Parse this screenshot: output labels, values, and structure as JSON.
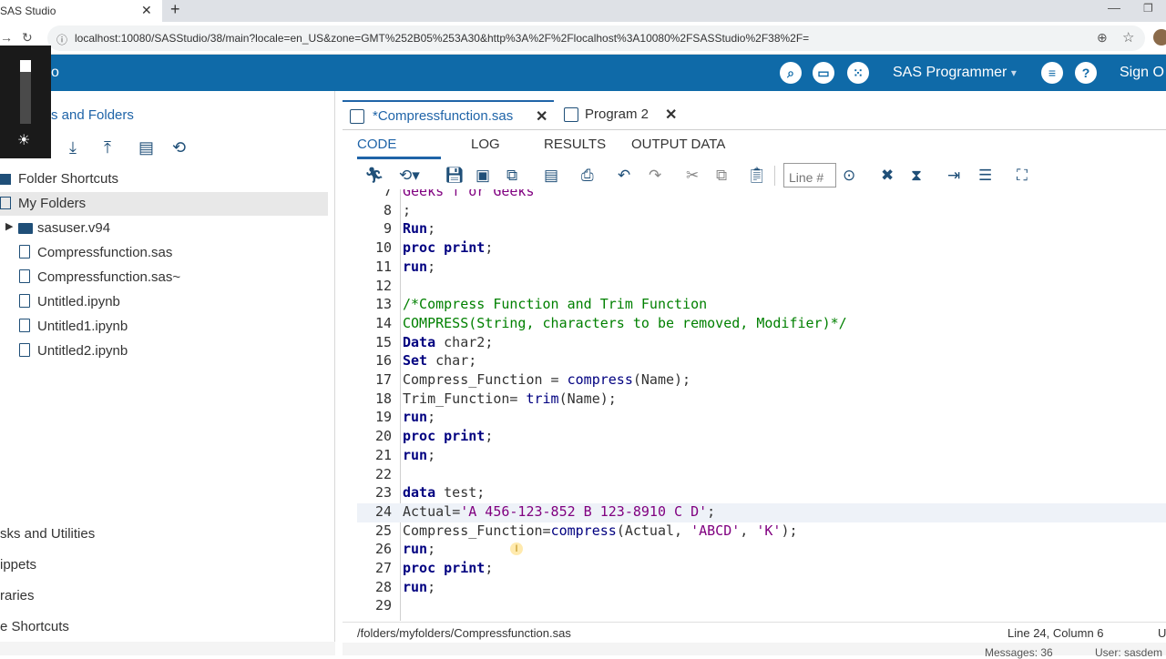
{
  "browser": {
    "tab_title": "SAS Studio",
    "tab_close": "✕",
    "new_tab": "+",
    "url": "localhost:10080/SASStudio/38/main?locale=en_US&zone=GMT%252B05%253A30&http%3A%2F%2Flocalhost%3A10080%2FSASStudio%2F38%2F="
  },
  "header": {
    "app_title_fragment": "o",
    "perspective": "SAS Programmer",
    "perspective_caret": "▾",
    "sign_out": "Sign O"
  },
  "left_panel": {
    "title_fragment": "s and Folders",
    "tree": [
      {
        "label": "Folder Shortcuts",
        "type": "shortcut"
      },
      {
        "label": "My Folders",
        "type": "folder",
        "selected": true
      },
      {
        "label": "sasuser.v94",
        "type": "folder"
      },
      {
        "label": "Compressfunction.sas",
        "type": "sas"
      },
      {
        "label": "Compressfunction.sas~",
        "type": "file"
      },
      {
        "label": "Untitled.ipynb",
        "type": "file"
      },
      {
        "label": "Untitled1.ipynb",
        "type": "file"
      },
      {
        "label": "Untitled2.ipynb",
        "type": "file"
      }
    ],
    "sections": [
      "sks and Utilities",
      "ippets",
      "raries",
      "e Shortcuts"
    ]
  },
  "editor": {
    "tabs": [
      {
        "label": "*Compressfunction.sas",
        "active": true
      },
      {
        "label": "Program 2",
        "active": false
      }
    ],
    "subtabs": [
      "CODE",
      "LOG",
      "RESULTS",
      "OUTPUT DATA"
    ],
    "line_placeholder": "Line #",
    "code_lines": [
      {
        "n": "7",
        "text": "Geeks f or Geeks"
      },
      {
        "n": "8",
        "text": ";"
      },
      {
        "n": "9",
        "text": "Run;"
      },
      {
        "n": "10",
        "text": "proc print;"
      },
      {
        "n": "11",
        "text": "run;"
      },
      {
        "n": "12",
        "text": ""
      },
      {
        "n": "13",
        "text": "/*Compress Function and Trim Function"
      },
      {
        "n": "14",
        "text": "COMPRESS(String, characters to be removed, Modifier)*/"
      },
      {
        "n": "15",
        "text": "Data char2;"
      },
      {
        "n": "16",
        "text": "Set char;"
      },
      {
        "n": "17",
        "text": "Compress_Function = compress(Name);"
      },
      {
        "n": "18",
        "text": "Trim_Function= trim(Name);"
      },
      {
        "n": "19",
        "text": "run;"
      },
      {
        "n": "20",
        "text": "proc print;"
      },
      {
        "n": "21",
        "text": "run;"
      },
      {
        "n": "22",
        "text": ""
      },
      {
        "n": "23",
        "text": "data test;"
      },
      {
        "n": "24",
        "text": "Actual='A 456-123-852 B 123-8910 C D';"
      },
      {
        "n": "25",
        "text": "Compress_Function=compress(Actual, 'ABCD', 'K');"
      },
      {
        "n": "26",
        "text": "run;"
      },
      {
        "n": "27",
        "text": "proc print;"
      },
      {
        "n": "28",
        "text": "run;"
      },
      {
        "n": "29",
        "text": ""
      }
    ],
    "current_line": "24",
    "status_path": "/folders/myfolders/Compressfunction.sas",
    "status_position": "Line 24, Column 6",
    "status_extra": "U"
  },
  "footer": {
    "messages": "Messages: 36",
    "user": "User: sasdem"
  }
}
